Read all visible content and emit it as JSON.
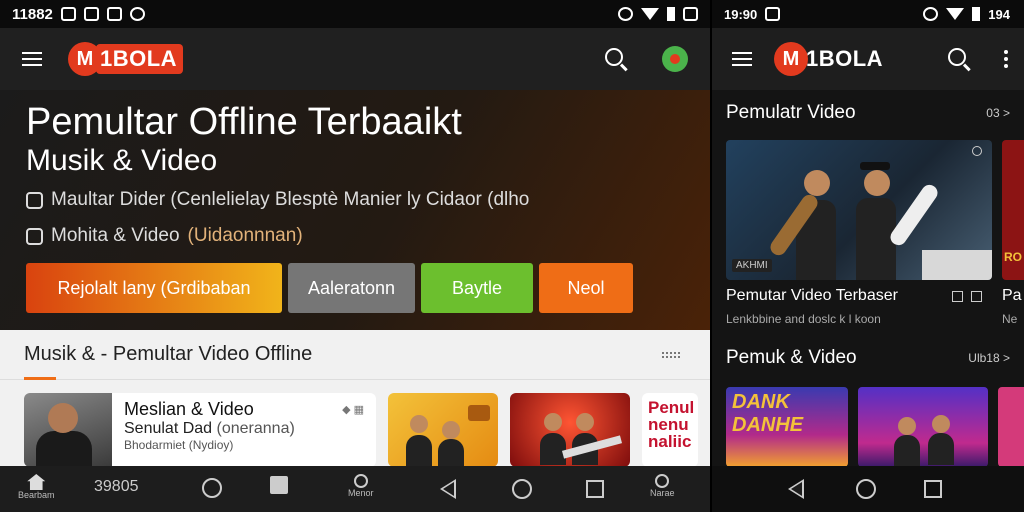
{
  "left": {
    "status": {
      "time": "11882"
    },
    "appbar": {
      "logo_letter": "M",
      "logo_text": "1BOLA"
    },
    "hero": {
      "title": "Pemultar Offline Terbaaikt",
      "subtitle": "Musik & Video",
      "line1": "Maultar Dider (Cenlelielay Blesptè Manier ly Cidaor (dlho",
      "line2_main": "Mohita & Video",
      "line2_dim": "(Uidaonnnan)",
      "buttons": [
        "Rejolalt lany (Grdibaban",
        "Aaleratonn",
        "Baytle",
        "Neol"
      ]
    },
    "section": {
      "title": "Musik & - Pemultar Video Offline",
      "card1": {
        "title": "Meslian & Video",
        "line2": "Senulat Dad",
        "line2_dim": "(oneranna)",
        "line3": "Bhodarmiet (Nydioy)"
      },
      "card4_text": "Penul nenu naliic"
    },
    "nav": {
      "label_home": "Bearbam",
      "counter": "39805",
      "label_profile": "Menor",
      "label_account": "Narae"
    }
  },
  "right": {
    "status": {
      "time": "19:90",
      "battery": "194"
    },
    "appbar": {
      "logo_letter": "M",
      "logo_text": "1BOLA"
    },
    "section1": {
      "title": "Pemulatr Video",
      "more": "03 >"
    },
    "card1": {
      "badge": "AKHMI",
      "caption": "Pemutar Video Terbaser",
      "sub": "Lenkbbine and doslc k l koon"
    },
    "card1b": {
      "text": "RO",
      "caption": "Pa",
      "sub": "Ne"
    },
    "section2": {
      "title": "Pemuk & Video",
      "more": "Ulb18 >"
    },
    "poster1": {
      "text": "DANK DANHE"
    }
  }
}
